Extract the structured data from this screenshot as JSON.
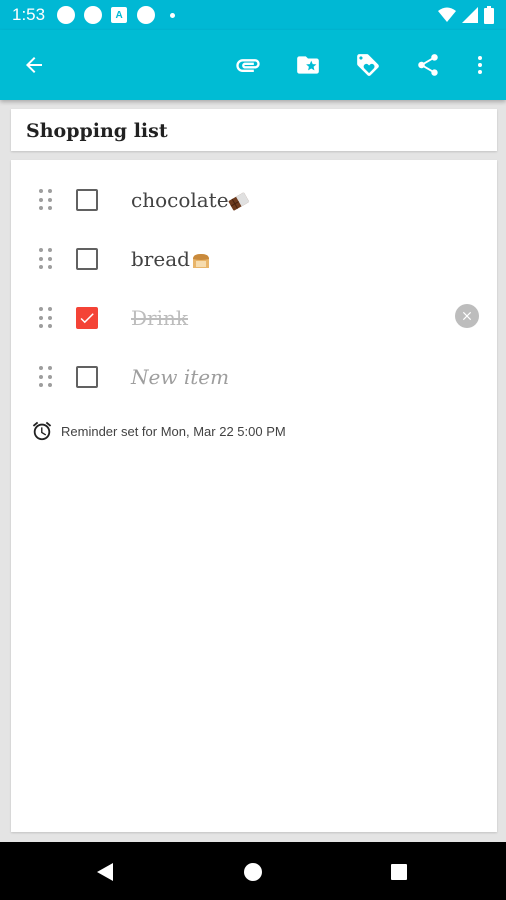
{
  "status_bar": {
    "time": "1:53"
  },
  "toolbar": {
    "back_icon": "arrow-left-icon",
    "attach_icon": "paperclip-icon",
    "category_icon": "folder-star-icon",
    "tag_icon": "tag-icon",
    "share_icon": "share-icon",
    "more_icon": "more-vert-icon"
  },
  "note": {
    "title": "Shopping list",
    "items": [
      {
        "text": "chocolate",
        "checked": false,
        "emoji": "chocolate-bar"
      },
      {
        "text": "bread",
        "checked": false,
        "emoji": "bread"
      },
      {
        "text": "Drink",
        "checked": true
      }
    ],
    "new_item_placeholder": "New item",
    "reminder": "Reminder set for Mon, Mar 22 5:00 PM"
  },
  "colors": {
    "status_bar": "#00b8d4",
    "app_bar": "#00bcd4",
    "checked": "#f44336",
    "background": "#e4e4e4"
  }
}
